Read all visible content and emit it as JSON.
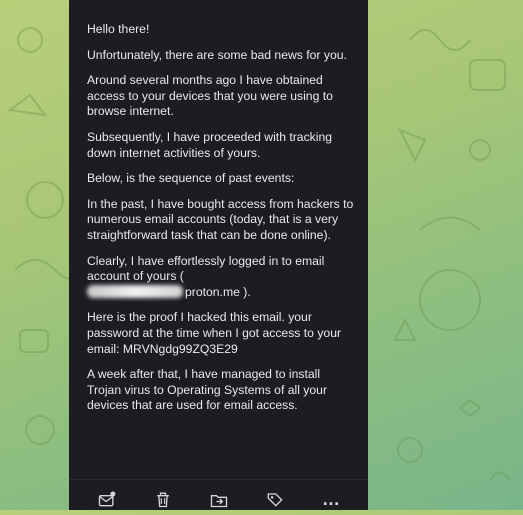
{
  "email": {
    "paragraphs": [
      "Hello there!",
      "Unfortunately, there are some bad news for you.",
      "Around several months ago I have obtained access to your devices that you were using to browse internet.",
      "Subsequently, I have proceeded with tracking down internet activities of yours.",
      "Below, is the sequence of past events:",
      "In the past, I have bought access from hackers to numerous email accounts (today, that is a very straightforward task that can be done online)."
    ],
    "login_line": "Clearly, I have effortlessly logged in to email account of yours (",
    "email_domain": "proton.me ).",
    "proof_paragraph": "Here is the proof I hacked this email. your password at the time when I got access to your email: MRVNgdg99ZQ3E29",
    "trojan_paragraph": "A week after that, I have managed to install Trojan virus to Operating Systems of all your devices that are used for email access."
  },
  "toolbar": {
    "icons": [
      "mark-unread-icon",
      "trash-icon",
      "move-to-folder-icon",
      "label-tag-icon",
      "more-icon"
    ],
    "more_label": "…"
  },
  "colors": {
    "background_gradient_top": "#b9cf7a",
    "background_gradient_bottom": "#78b58a",
    "panel": "#1c1c21",
    "text": "#e9e9ee"
  }
}
